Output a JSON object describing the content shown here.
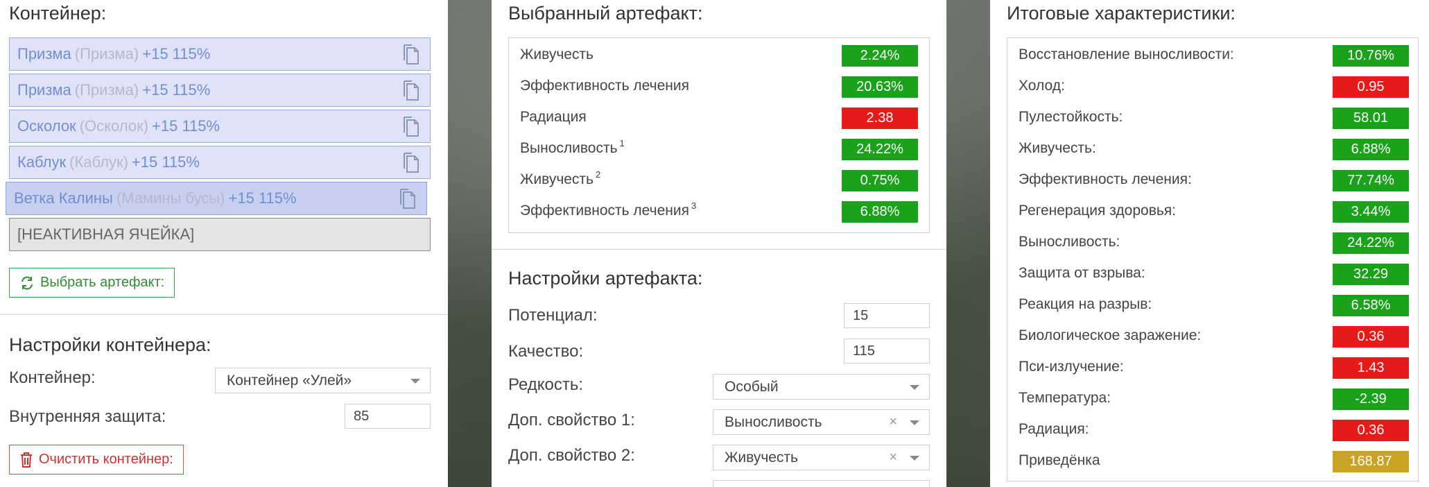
{
  "container_panel": {
    "title": "Контейнер:",
    "slots": [
      {
        "name": "Призма",
        "sub": "(Призма)",
        "bonus": "+15 115%"
      },
      {
        "name": "Призма",
        "sub": "(Призма)",
        "bonus": "+15 115%"
      },
      {
        "name": "Осколок",
        "sub": "(Осколок)",
        "bonus": "+15 115%"
      },
      {
        "name": "Каблук",
        "sub": "(Каблук)",
        "bonus": "+15 115%"
      },
      {
        "name": "Ветка Калины",
        "sub": "(Мамины бусы)",
        "bonus": "+15 115%"
      }
    ],
    "inactive_slot": "[НЕАКТИВНАЯ ЯЧЕЙКА]",
    "select_button": "Выбрать артефакт:",
    "settings_title": "Настройки контейнера:",
    "container_label": "Контейнер:",
    "container_value": "Контейнер «Улей»",
    "protection_label": "Внутренняя защита:",
    "protection_value": "85",
    "clear_button": "Очистить контейнер:"
  },
  "artifact_panel": {
    "title": "Выбранный артефакт:",
    "stats": [
      {
        "name": "Живучесть",
        "sup": "",
        "value": "2.24%",
        "color": "#1aa31a"
      },
      {
        "name": "Эффективность лечения",
        "sup": "",
        "value": "20.63%",
        "color": "#1aa31a"
      },
      {
        "name": "Радиация",
        "sup": "",
        "value": "2.38",
        "color": "#e81919"
      },
      {
        "name": "Выносливость",
        "sup": "1",
        "value": "24.22%",
        "color": "#1aa31a"
      },
      {
        "name": "Живучесть",
        "sup": "2",
        "value": "0.75%",
        "color": "#1aa31a"
      },
      {
        "name": "Эффективность лечения",
        "sup": "3",
        "value": "6.88%",
        "color": "#1aa31a"
      }
    ],
    "settings_title": "Настройки артефакта:",
    "potential_label": "Потенциал:",
    "potential_value": "15",
    "quality_label": "Качество:",
    "quality_value": "115",
    "rarity_label": "Редкость:",
    "rarity_value": "Особый",
    "extra1_label": "Доп. свойство 1:",
    "extra1_value": "Выносливость",
    "extra2_label": "Доп. свойство 2:",
    "extra2_value": "Живучесть",
    "clear_symbol": "×"
  },
  "totals_panel": {
    "title": "Итоговые характеристики:",
    "stats": [
      {
        "name": "Восстановление выносливости:",
        "value": "10.76%",
        "color": "#1aa31a"
      },
      {
        "name": "Холод:",
        "value": "0.95",
        "color": "#e81919"
      },
      {
        "name": "Пулестойкость:",
        "value": "58.01",
        "color": "#1aa31a"
      },
      {
        "name": "Живучесть:",
        "value": "6.88%",
        "color": "#1aa31a"
      },
      {
        "name": "Эффективность лечения:",
        "value": "77.74%",
        "color": "#1aa31a"
      },
      {
        "name": "Регенерация здоровья:",
        "value": "3.44%",
        "color": "#1aa31a"
      },
      {
        "name": "Выносливость:",
        "value": "24.22%",
        "color": "#1aa31a"
      },
      {
        "name": "Защита от взрыва:",
        "value": "32.29",
        "color": "#1aa31a"
      },
      {
        "name": "Реакция на разрыв:",
        "value": "6.58%",
        "color": "#1aa31a"
      },
      {
        "name": "Биологическое заражение:",
        "value": "0.36",
        "color": "#e81919"
      },
      {
        "name": "Пси-излучение:",
        "value": "1.43",
        "color": "#e81919"
      },
      {
        "name": "Температура:",
        "value": "-2.39",
        "color": "#1aa31a"
      },
      {
        "name": "Радиация:",
        "value": "0.36",
        "color": "#e81919"
      },
      {
        "name": "Приведёнка",
        "value": "168.87",
        "color": "#c9a224"
      }
    ]
  }
}
